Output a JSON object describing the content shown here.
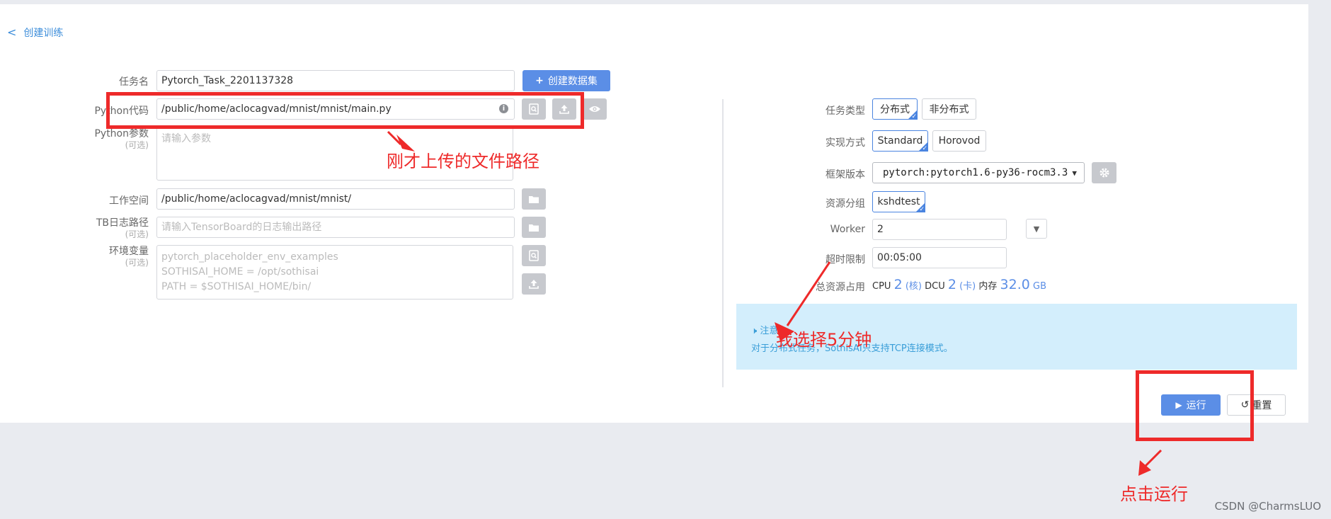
{
  "page": {
    "back_label": "创建训练"
  },
  "left_form": {
    "task_name": {
      "label": "任务名",
      "value": "Pytorch_Task_2201137328"
    },
    "create_dataset_button": "创建数据集",
    "python_code": {
      "label": "Python代码",
      "value": "/public/home/aclocagvad/mnist/mnist/main.py"
    },
    "python_params": {
      "label": "Python参数",
      "optional": "(可选)",
      "placeholder": "请输入参数"
    },
    "workspace": {
      "label": "工作空间",
      "value": "/public/home/aclocagvad/mnist/mnist/"
    },
    "tb_log_path": {
      "label": "TB日志路径",
      "optional": "(可选)",
      "placeholder": "请输入TensorBoard的日志输出路径"
    },
    "env_vars": {
      "label": "环境变量",
      "optional": "(可选)",
      "placeholder_lines": [
        "pytorch_placeholder_env_examples",
        "SOTHISAI_HOME = /opt/sothisai",
        "PATH = $SOTHISAI_HOME/bin/"
      ]
    }
  },
  "right_form": {
    "task_type": {
      "label": "任务类型",
      "options": [
        "分布式",
        "非分布式"
      ],
      "selected": "分布式"
    },
    "impl": {
      "label": "实现方式",
      "options": [
        "Standard",
        "Horovod"
      ],
      "selected": "Standard"
    },
    "framework": {
      "label": "框架版本",
      "selected": "pytorch:pytorch1.6-py36-rocm3.3"
    },
    "resource_group": {
      "label": "资源分组",
      "selected": "kshdtest"
    },
    "worker": {
      "label": "Worker",
      "value": "2"
    },
    "timeout": {
      "label": "超时限制",
      "value": "00:05:00"
    },
    "total_resources": {
      "label": "总资源占用",
      "cpu_label": "CPU",
      "cpu_value": "2",
      "cpu_unit": "(核)",
      "dcu_label": "DCU",
      "dcu_value": "2",
      "dcu_unit": "(卡)",
      "mem_label": "内存",
      "mem_value": "32.0",
      "mem_unit": "GB"
    },
    "notice": {
      "title": "注意",
      "text": "对于分布式任务，SothisAI只支持TCP连接模式。"
    }
  },
  "actions": {
    "run_button": "运行",
    "reset_button": "重置"
  },
  "annotations": {
    "file_path_note": "刚才上传的文件路径",
    "timeout_note": "我选择5分钟",
    "run_note": "点击运行",
    "color": "#ee2a2a"
  },
  "watermark": "CSDN @CharmsLUO",
  "colors": {
    "primary": "#5b8ee6",
    "link": "#3c8dda",
    "notice_bg": "#d3eefc"
  }
}
